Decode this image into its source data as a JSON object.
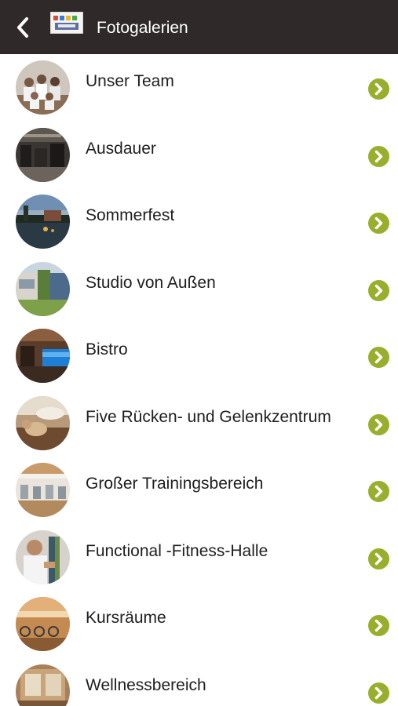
{
  "header": {
    "title": "Fotogalerien",
    "back_icon": "chevron-left-icon",
    "logo_icon": "gym-logo-icon",
    "background_color": "#2f2a29"
  },
  "gallery": {
    "items": [
      {
        "label": "Unser Team",
        "thumbnail": "team-photo"
      },
      {
        "label": "Ausdauer",
        "thumbnail": "cardio-area-photo"
      },
      {
        "label": "Sommerfest",
        "thumbnail": "pond-at-dusk-photo"
      },
      {
        "label": "Studio von Außen",
        "thumbnail": "building-exterior-photo"
      },
      {
        "label": "Bistro",
        "thumbnail": "bistro-photo"
      },
      {
        "label": "Five Rücken- und Gelenkzentrum",
        "thumbnail": "back-training-photo"
      },
      {
        "label": "Großer Trainingsbereich",
        "thumbnail": "training-hall-photo"
      },
      {
        "label": "Functional -Fitness-Halle",
        "thumbnail": "functional-fitness-photo"
      },
      {
        "label": "Kursräume",
        "thumbnail": "spinning-room-photo"
      },
      {
        "label": "Wellnessbereich",
        "thumbnail": "sauna-photo"
      }
    ],
    "chevron_icon": "chevron-right-circle-icon",
    "accent_color": "#9aae2e"
  }
}
